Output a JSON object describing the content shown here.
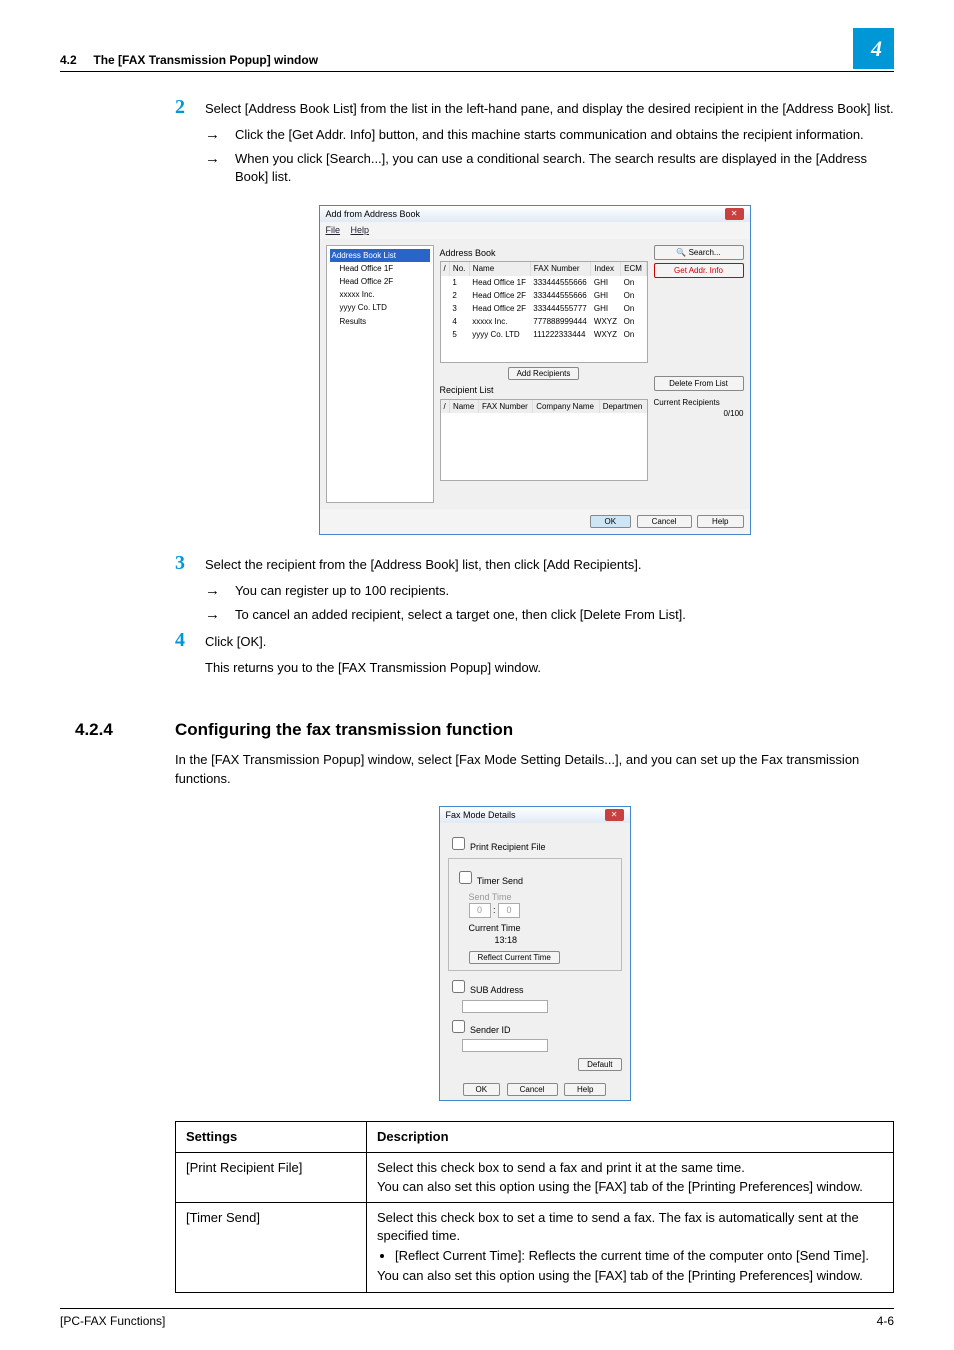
{
  "header": {
    "section_number": "4.2",
    "section_title": "The [FAX Transmission Popup] window",
    "chapter_marker": "4"
  },
  "step2": {
    "num": "2",
    "text": "Select [Address Book List] from the list in the left-hand pane, and display the desired recipient in the [Address Book] list.",
    "bullet_a": "Click the [Get Addr. Info] button, and this machine starts communication and obtains the recipient information.",
    "bullet_b": "When you click [Search...], you can use a conditional search. The search results are displayed in the [Address Book] list."
  },
  "dialog1": {
    "title": "Add from Address Book",
    "menu_file": "File",
    "menu_help": "Help",
    "tree_root": "Address Book List",
    "tree_items": [
      "Head Office 1F",
      "Head Office 2F",
      "xxxxx Inc.",
      "yyyy Co. LTD",
      "Results"
    ],
    "address_book_label": "Address Book",
    "search_btn": "Search...",
    "getaddr_btn": "Get Addr. Info",
    "cols": {
      "chk": "/",
      "no": "No.",
      "name": "Name",
      "fax": "FAX Number",
      "index": "Index",
      "ecm": "ECM"
    },
    "rows": [
      {
        "no": "1",
        "name": "Head Office 1F",
        "fax": "333444555666",
        "index": "GHI",
        "ecm": "On"
      },
      {
        "no": "2",
        "name": "Head Office 2F",
        "fax": "333444555666",
        "index": "GHI",
        "ecm": "On"
      },
      {
        "no": "3",
        "name": "Head Office 2F",
        "fax": "333444555777",
        "index": "GHI",
        "ecm": "On"
      },
      {
        "no": "4",
        "name": "xxxxx Inc.",
        "fax": "777888999444",
        "index": "WXYZ",
        "ecm": "On"
      },
      {
        "no": "5",
        "name": "yyyy Co. LTD",
        "fax": "111222333444",
        "index": "WXYZ",
        "ecm": "On"
      }
    ],
    "add_recipients_btn": "Add Recipients",
    "recipient_list_label": "Recipient List",
    "delete_btn": "Delete From List",
    "current_recipients_label": "Current Recipients",
    "current_recipients_count": "0/100",
    "rcols": {
      "chk": "/",
      "name": "Name",
      "fax": "FAX Number",
      "company": "Company Name",
      "dept": "Departmen"
    },
    "ok": "OK",
    "cancel": "Cancel",
    "help": "Help"
  },
  "step3": {
    "num": "3",
    "text": "Select the recipient from the [Address Book] list, then click [Add Recipients].",
    "bullet_a": "You can register up to 100 recipients.",
    "bullet_b": "To cancel an added recipient, select a target one, then click [Delete From List]."
  },
  "step4": {
    "num": "4",
    "text": "Click [OK].",
    "follow": "This returns you to the [FAX Transmission Popup] window."
  },
  "section424": {
    "num": "4.2.4",
    "title": "Configuring the fax transmission function",
    "intro": "In the [FAX Transmission Popup] window, select [Fax Mode Setting Details...], and you can set up the Fax transmission functions."
  },
  "dialog2": {
    "title": "Fax Mode Details",
    "print_recipient": "Print Recipient File",
    "timer_send": "Timer Send",
    "send_time": "Send Time",
    "h": "0",
    "m": "0",
    "current_time_label": "Current Time",
    "current_time_value": "13:18",
    "reflect_btn": "Reflect Current Time",
    "sub_address": "SUB Address",
    "sender_id": "Sender ID",
    "default_btn": "Default",
    "ok": "OK",
    "cancel": "Cancel",
    "help": "Help"
  },
  "table": {
    "h1": "Settings",
    "h2": "Description",
    "r1_name": "[Print Recipient File]",
    "r1_desc": "Select this check box to send a fax and print it at the same time.\nYou can also set this option using the [FAX] tab of the [Printing Preferences] window.",
    "r2_name": "[Timer Send]",
    "r2_desc_a": "Select this check box to set a time to send a fax. The fax is automatically sent at the specified time.",
    "r2_desc_b": "[Reflect Current Time]: Reflects the current time of the computer onto [Send Time].",
    "r2_desc_c": "You can also set this option using the [FAX] tab of the [Printing Preferences] window."
  },
  "footer": {
    "left": "[PC-FAX Functions]",
    "right": "4-6"
  }
}
